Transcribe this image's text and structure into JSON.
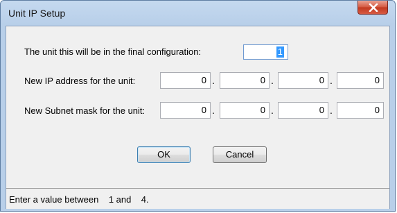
{
  "window": {
    "title": "Unit IP Setup"
  },
  "unit": {
    "label": "The unit this will be in the final configuration:",
    "value": "1"
  },
  "ip": {
    "label": "New IP address for the unit:",
    "octets": [
      "0",
      "0",
      "0",
      "0"
    ],
    "separator": "."
  },
  "subnet": {
    "label": "New Subnet mask for the unit:",
    "octets": [
      "0",
      "0",
      "0",
      "0"
    ],
    "separator": "."
  },
  "buttons": {
    "ok": "OK",
    "cancel": "Cancel"
  },
  "status": {
    "text": "Enter a value between    1 and    4."
  },
  "icons": {
    "close": "close-icon"
  }
}
